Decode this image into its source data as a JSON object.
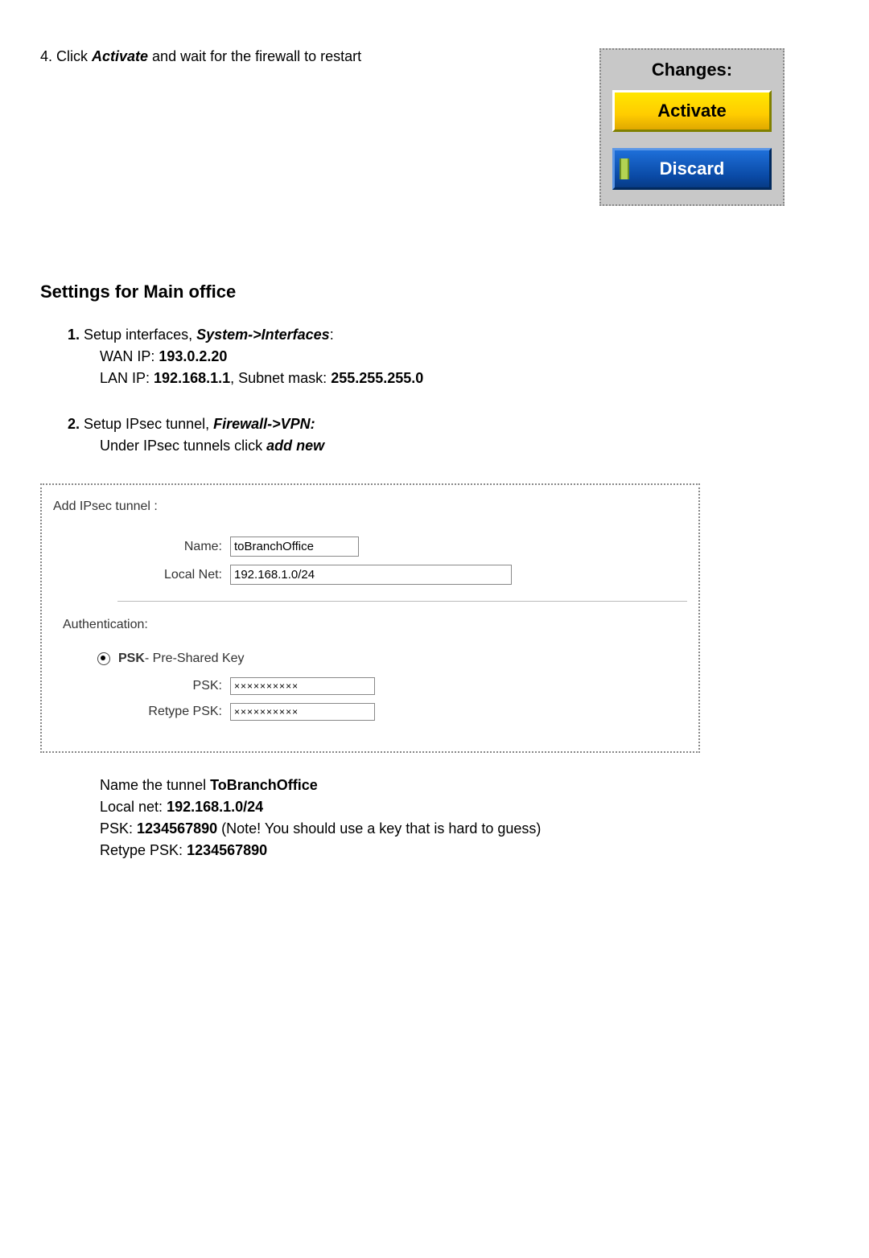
{
  "step4": {
    "prefix": "4. Click ",
    "bold": "Activate",
    "suffix": " and wait for the firewall to restart"
  },
  "changes_panel": {
    "title": "Changes:",
    "activate_label": "Activate",
    "discard_label": "Discard"
  },
  "section_heading": "Settings for Main office",
  "step1": {
    "num": "1.",
    "text": " Setup interfaces, ",
    "menu": "System->Interfaces",
    "colon": ":",
    "wan_prefix": "WAN IP: ",
    "wan_ip": "193.0.2.20",
    "lan_prefix": "LAN IP: ",
    "lan_ip": "192.168.1.1",
    "lan_mid": ", Subnet mask: ",
    "lan_mask": "255.255.255.0"
  },
  "step2": {
    "num": "2.",
    "text": " Setup IPsec tunnel, ",
    "menu": "Firewall->VPN:",
    "sub_prefix": "Under IPsec tunnels click ",
    "sub_bold": "add new"
  },
  "ipsec_box": {
    "title": "Add IPsec tunnel :",
    "name_label": "Name:",
    "name_value": "toBranchOffice",
    "localnet_label": "Local Net:",
    "localnet_value": "192.168.1.0/24",
    "auth_title": "Authentication:",
    "psk_bold": "PSK",
    "psk_desc": " - Pre-Shared Key",
    "psk_label": "PSK:",
    "psk_value": "××××××××××",
    "retype_label": "Retype PSK:",
    "retype_value": "××××××××××"
  },
  "after": {
    "l1a": "Name the tunnel ",
    "l1b": "ToBranchOffice",
    "l2a": "Local net: ",
    "l2b": "192.168.1.0/24",
    "l3a": "PSK: ",
    "l3b": "1234567890",
    "l3c": " (Note! You should use a key that is hard to guess)",
    "l4a": "Retype PSK: ",
    "l4b": "1234567890"
  }
}
